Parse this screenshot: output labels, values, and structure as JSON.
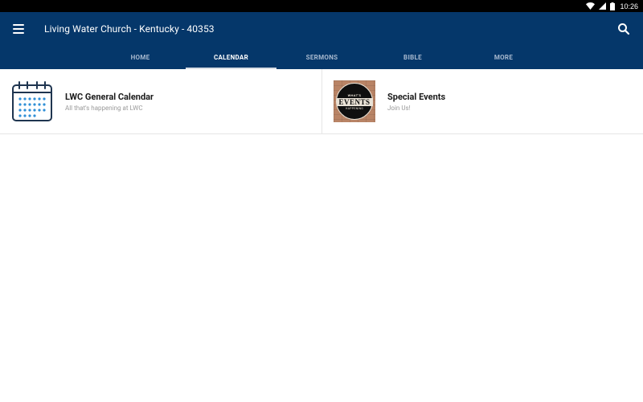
{
  "status_bar": {
    "time": "10:26",
    "icons": [
      "wifi-icon",
      "signal-icon",
      "battery-icon"
    ]
  },
  "toolbar": {
    "title": "Living Water Church - Kentucky - 40353",
    "menu_icon": "hamburger-menu-icon",
    "search_icon": "search-icon"
  },
  "tabs": [
    {
      "label": "HOME",
      "active": false
    },
    {
      "label": "CALENDAR",
      "active": true
    },
    {
      "label": "SERMONS",
      "active": false
    },
    {
      "label": "BIBLE",
      "active": false
    },
    {
      "label": "MORE",
      "active": false
    }
  ],
  "cards": [
    {
      "title": "LWC General Calendar",
      "subtitle": "All that's happening at LWC",
      "icon": "calendar-icon"
    },
    {
      "title": "Special Events",
      "subtitle": "Join Us!",
      "icon": "events-thumbnail",
      "thumb_text": {
        "top": "WHAT'S",
        "main": "EVENTS",
        "bottom": "HAPPENING"
      }
    }
  ],
  "colors": {
    "app_bar": "#05376a",
    "status_bar": "#000000",
    "tab_inactive": "#a8b9cf",
    "tab_active": "#ffffff",
    "calendar_accent": "#2f8fd6",
    "calendar_outline": "#1f3550"
  }
}
